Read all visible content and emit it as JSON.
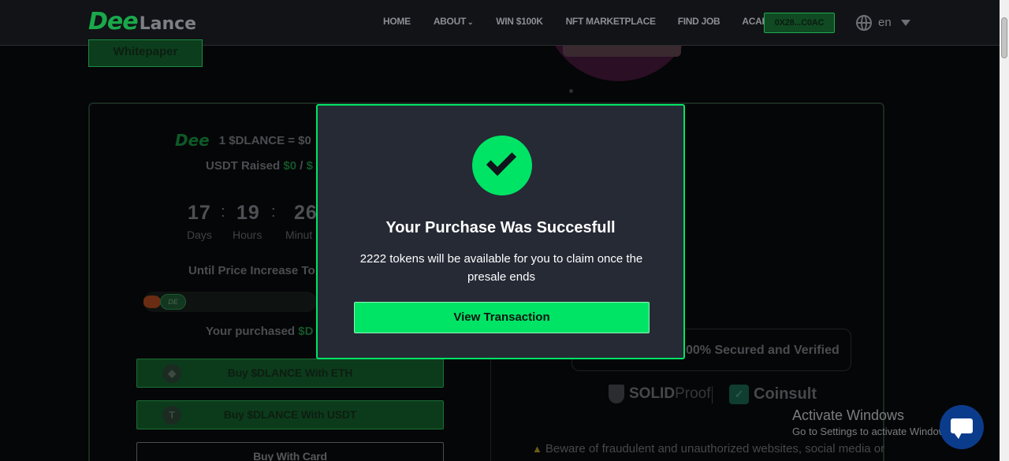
{
  "header": {
    "logo_primary": "Dee",
    "logo_secondary": "Lance",
    "nav": [
      "HOME",
      "ABOUT",
      "WIN $100K",
      "NFT MARKETPLACE",
      "FIND JOB",
      "ACADEMY"
    ],
    "wallet_label": "0X28...C0AC",
    "language": "en"
  },
  "page": {
    "whitepaper_label": "Whitepaper",
    "price_logo": "Dee",
    "price_text": "1 $DLANCE = $0",
    "raised_label": "USDT Raised",
    "raised_value": "$0",
    "raised_sep": "/",
    "raised_total": "$",
    "timer": {
      "days": "17",
      "hours": "19",
      "minutes": "26",
      "days_label": "Days",
      "hours_label": "Hours",
      "minutes_label": "Minut"
    },
    "until_text": "Until Price Increase To",
    "rocket_label": "DE",
    "purchased_label": "Your purchased",
    "purchased_token": "$D",
    "buy_eth_label": "Buy $DLANCE With ETH",
    "buy_usdt_label": "Buy $DLANCE With USDT",
    "buy_card_label": "Buy With Card",
    "usdt_icon": "T",
    "secured_text": "00% Secured and Verified",
    "solid_bold": "SOLID",
    "solid_light": "Proof",
    "coinsult_label": "Coinsult",
    "beware_text": "Beware of fraudulent and unauthorized websites, social media or"
  },
  "windows": {
    "activate_title": "Activate Windows",
    "activate_sub": "Go to Settings to activate Windows."
  },
  "modal": {
    "title": "Your Purchase Was Succesfull",
    "message": "2222 tokens will be available for you to claim once the presale ends",
    "button_label": "View Transaction"
  },
  "colors": {
    "accent_green": "#00e466",
    "modal_bg": "#262a35",
    "page_bg": "#050607"
  }
}
